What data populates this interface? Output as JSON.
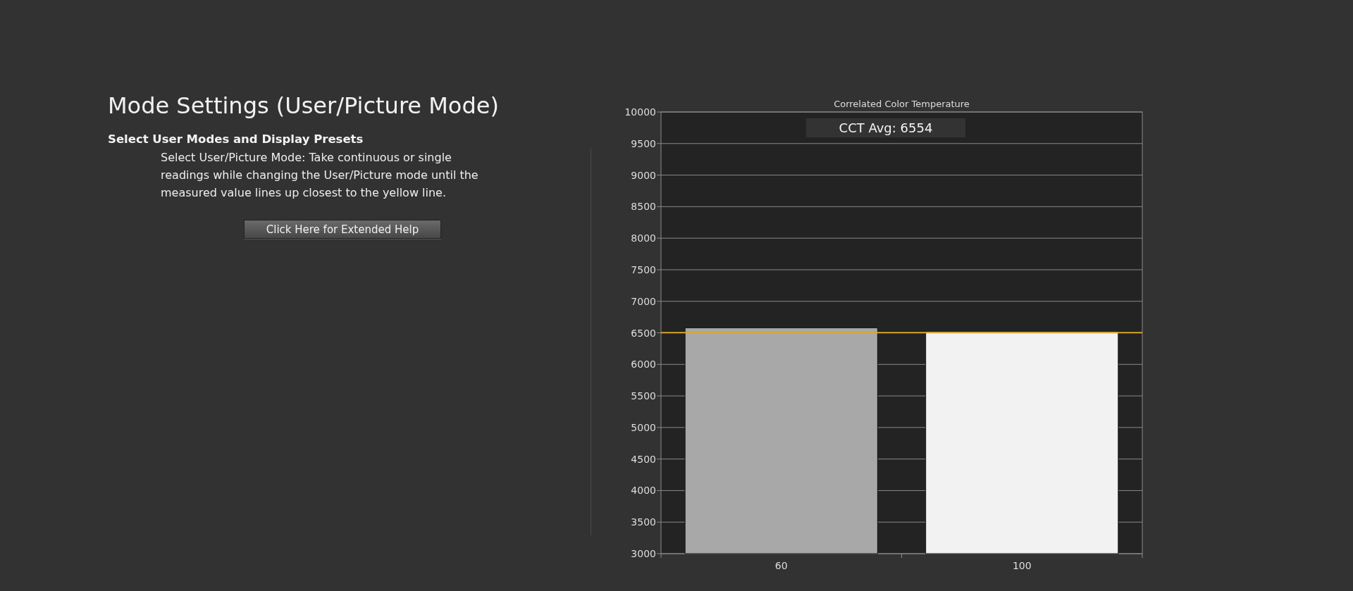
{
  "heading": {
    "title": "Mode Settings (User/Picture Mode)",
    "subtitle": "Select User Modes and Display Presets",
    "description": "Select User/Picture Mode: Take continuous or single readings while changing the User/Picture mode until the measured value lines up closest to the yellow line."
  },
  "help_button": "Click Here for Extended Help",
  "chart": {
    "badge": "CCT Avg: 6554",
    "chart_data": {
      "type": "bar",
      "title": "Correlated Color Temperature",
      "categories": [
        "60",
        "100"
      ],
      "series": [
        {
          "color": "#a8a8a8",
          "values": [
            6580,
            null
          ]
        },
        {
          "color": "#f2f2f2",
          "values": [
            null,
            6520
          ]
        }
      ],
      "stacked": true,
      "grid": true,
      "ylim": [
        3000,
        10000
      ],
      "yticks": [
        3000,
        3500,
        4000,
        4500,
        5000,
        5500,
        6000,
        6500,
        7000,
        7500,
        8000,
        8500,
        9000,
        9500,
        10000
      ],
      "ref_lines": [
        {
          "axis": "y",
          "value": 6504,
          "color": "#d9a629"
        }
      ]
    }
  }
}
